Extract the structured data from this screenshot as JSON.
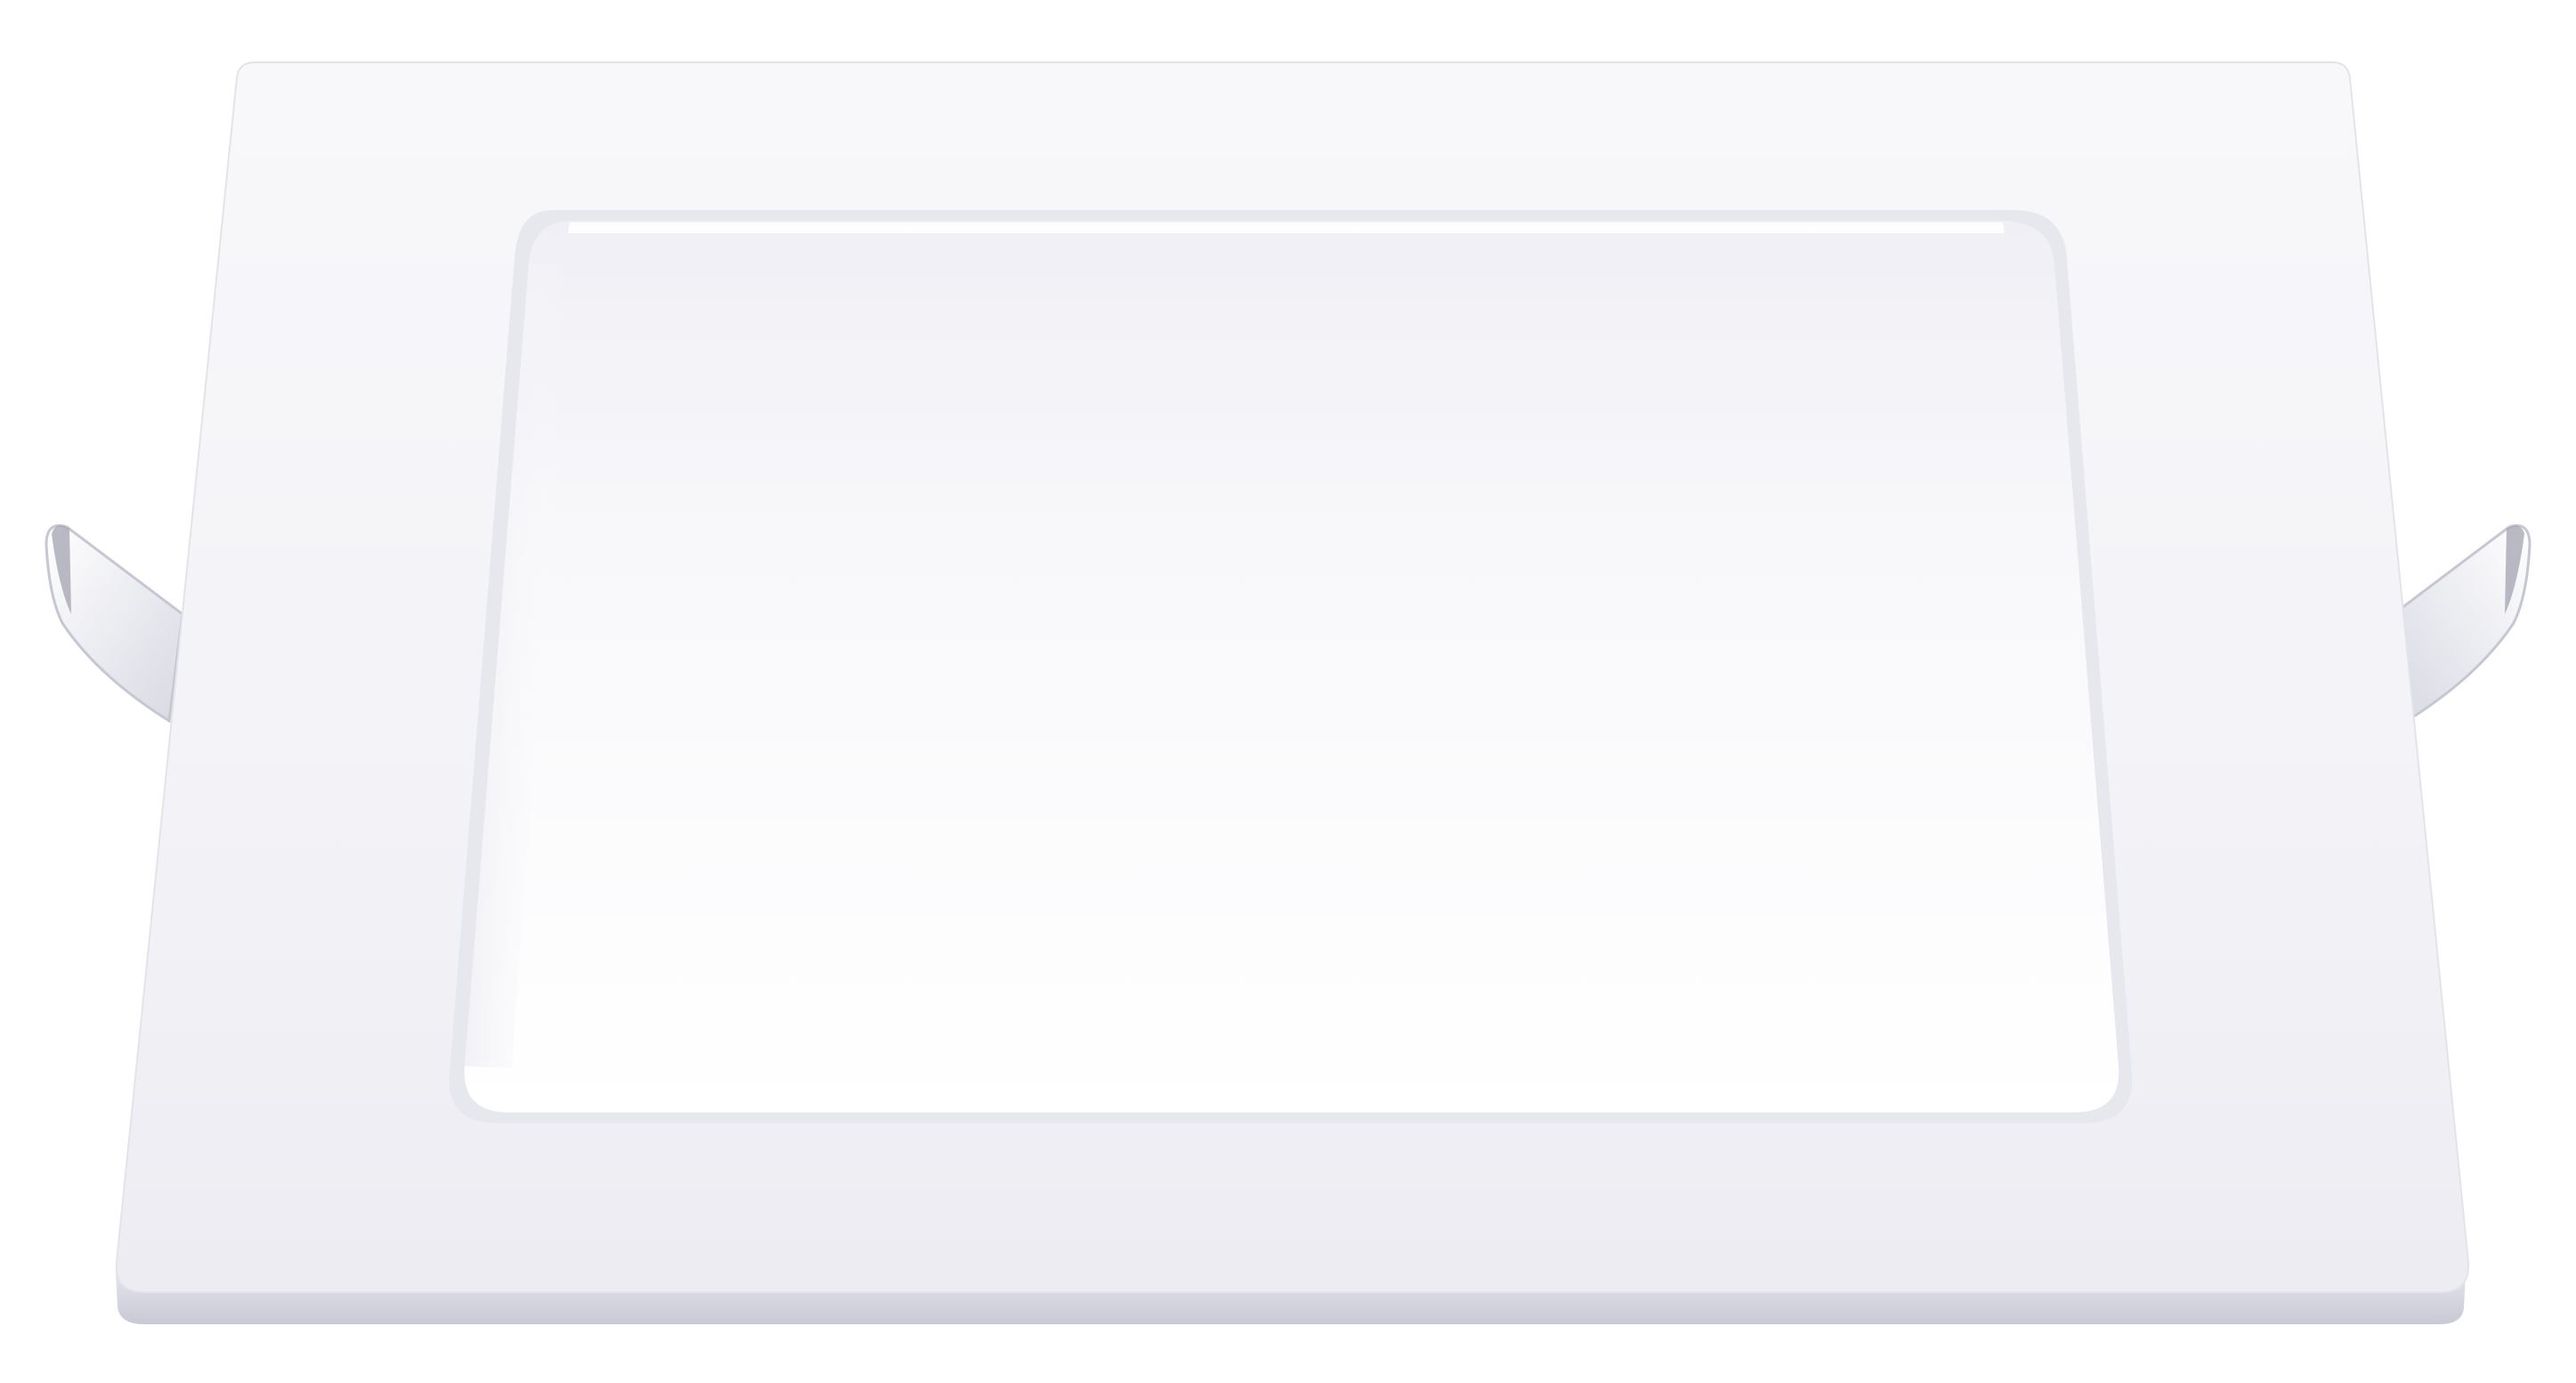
{
  "image": {
    "subject": "square-recessed-led-panel-light",
    "background_color": "#ffffff",
    "colors": {
      "frame": "#f7f7fa",
      "frame_edge": "#d9d9e2",
      "diffuser_top": "#f1f1f6",
      "diffuser_bottom": "#ffffff",
      "spring_clip": "#f2f2f6",
      "spring_clip_shadow": "#b9bac7"
    }
  }
}
